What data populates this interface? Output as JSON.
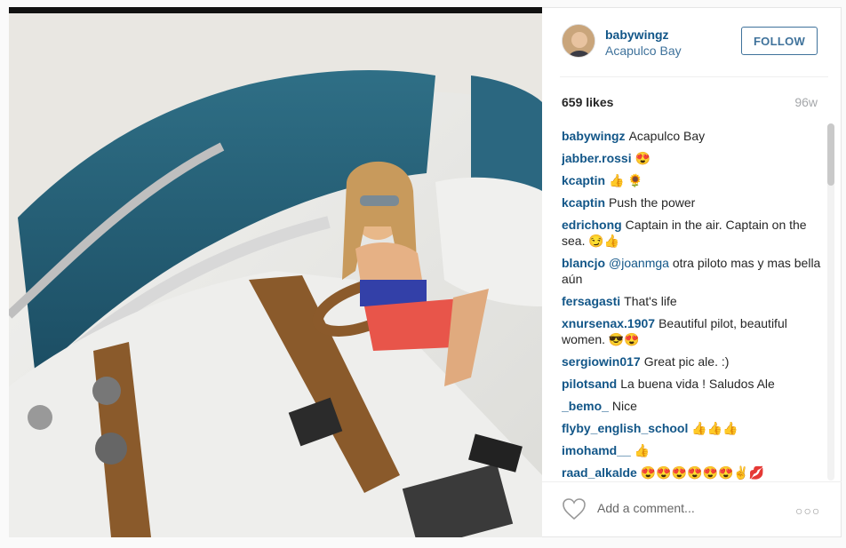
{
  "post": {
    "username": "babywingz",
    "location": "Acapulco Bay",
    "follow_label": "FOLLOW",
    "likes": "659 likes",
    "age": "96w",
    "add_comment_placeholder": "Add a comment...",
    "more_label": "○○○"
  },
  "comments": [
    {
      "user": "babywingz",
      "text": "Acapulco Bay"
    },
    {
      "user": "jabber.rossi",
      "text": "😍"
    },
    {
      "user": "kcaptin",
      "text": "👍 🌻"
    },
    {
      "user": "kcaptin",
      "text": "Push the power"
    },
    {
      "user": "edrichong",
      "text": "Captain in the air. Captain on the sea. 😏👍"
    },
    {
      "user": "blancjo",
      "mention": "@joanmga",
      "text": "otra piloto mas y mas bella aún"
    },
    {
      "user": "fersagasti",
      "text": "That's life"
    },
    {
      "user": "xnursenax.1907",
      "text": "Beautiful pilot, beautiful women. 😎😍"
    },
    {
      "user": "sergiowin017",
      "text": "Great pic ale. :)"
    },
    {
      "user": "pilotsand",
      "text": "La buena vida ! Saludos Ale"
    },
    {
      "user": "_bemo_",
      "text": "Nice"
    },
    {
      "user": "flyby_english_school",
      "text": "👍👍👍"
    },
    {
      "user": "imohamd__",
      "text": "👍"
    },
    {
      "user": "raad_alkalde",
      "text": "😍😍😍😍😍😍✌💋"
    }
  ],
  "icons": {
    "heart": "heart-outline-icon",
    "more": "more-options-icon"
  },
  "colors": {
    "link_blue": "#125688",
    "accent_blue": "#3f729b",
    "muted_gray": "#a5a7aa"
  }
}
